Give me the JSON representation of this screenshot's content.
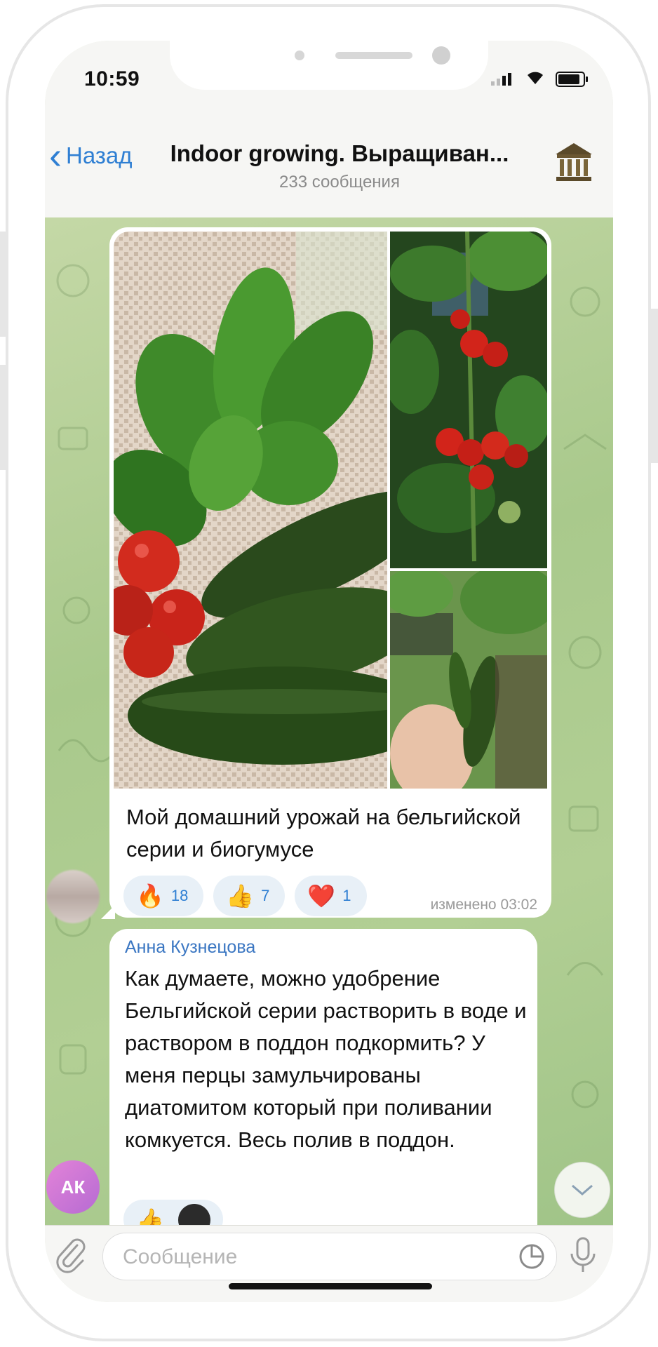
{
  "status_bar": {
    "time": "10:59"
  },
  "header": {
    "back_label": "Назад",
    "title": "Indoor growing. Выращиван...",
    "subtitle": "233 сообщения",
    "avatar_icon": "bank-building-icon"
  },
  "messages": [
    {
      "type": "photo_album",
      "caption": "Мой домашний урожай на бельгийской серии и биогумусе",
      "reactions": [
        {
          "emoji": "🔥",
          "count": "18"
        },
        {
          "emoji": "👍",
          "count": "7"
        },
        {
          "emoji": "❤️",
          "count": "1"
        }
      ],
      "edited_label": "изменено 03:02"
    },
    {
      "type": "text",
      "sender": "Анна Кузнецова",
      "sender_initials": "АК",
      "text": "Как думаете, можно удобрение Бельгийской серии растворить в воде и раствором в поддон подкормить? У меня перцы замульчированы диатомитом который при поливании комкуется. Весь полив в поддон.",
      "reaction_emoji": "👍"
    }
  ],
  "input": {
    "placeholder": "Сообщение"
  },
  "colors": {
    "accent": "#2f7fd3",
    "chat_bg": "#b2cf94",
    "sender_name": "#3a76c2"
  }
}
